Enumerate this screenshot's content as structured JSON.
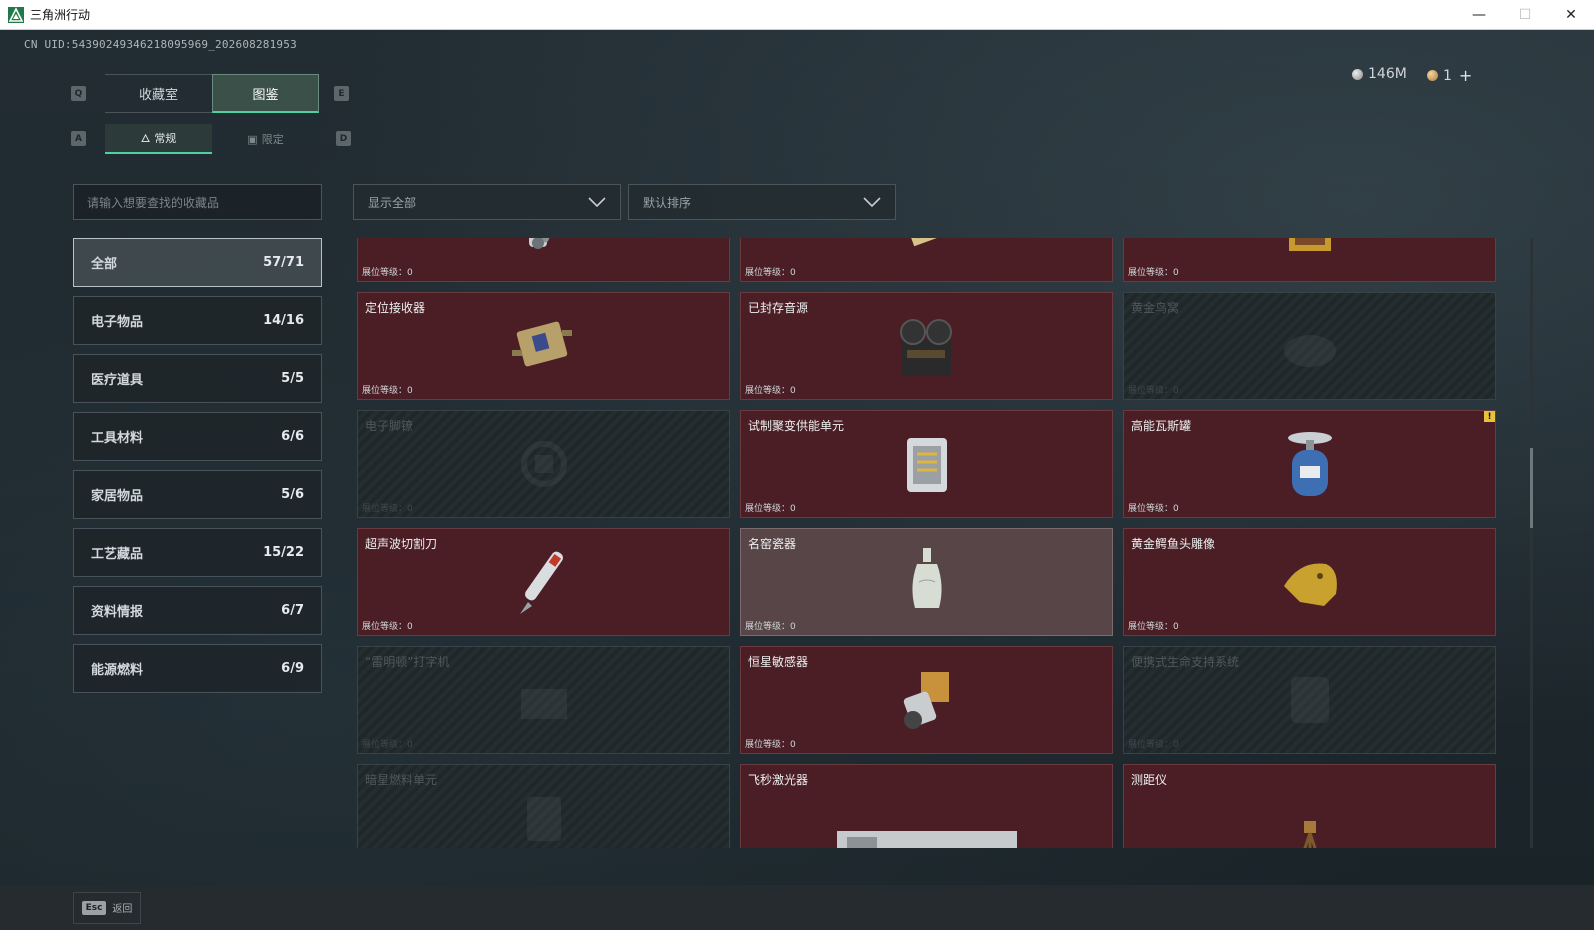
{
  "window": {
    "title": "三角洲行动",
    "minimize": "—",
    "maximize": "☐",
    "close": "✕"
  },
  "uid_text": "CN UID:54390249346218095969_202608281953",
  "currency": {
    "silver": "146M",
    "gold": "1",
    "plus": "+"
  },
  "keyhints": {
    "tab_left": "Q",
    "tab_right": "E",
    "sub_left": "A",
    "sub_right": "D"
  },
  "tabs": [
    {
      "label": "收藏室"
    },
    {
      "label": "图鉴"
    }
  ],
  "subtabs": [
    {
      "label": "常规",
      "icon": "flame-icon"
    },
    {
      "label": "限定",
      "icon": "picture-icon"
    }
  ],
  "search": {
    "placeholder": "请输入想要查找的收藏品"
  },
  "filter": {
    "value": "显示全部"
  },
  "sort": {
    "value": "默认排序"
  },
  "categories": [
    {
      "label": "全部",
      "count": "57/71"
    },
    {
      "label": "电子物品",
      "count": "14/16"
    },
    {
      "label": "医疗道具",
      "count": "5/5"
    },
    {
      "label": "工具材料",
      "count": "6/6"
    },
    {
      "label": "家居物品",
      "count": "5/6"
    },
    {
      "label": "工艺藏品",
      "count": "15/22"
    },
    {
      "label": "资料情报",
      "count": "6/7"
    },
    {
      "label": "能源燃料",
      "count": "6/9"
    }
  ],
  "level_label": "展位等级：0",
  "items": [
    {
      "name": "",
      "state": "owned",
      "icon": "mechanical-arm-icon"
    },
    {
      "name": "",
      "state": "owned",
      "icon": "ornate-book-icon"
    },
    {
      "name": "",
      "state": "owned",
      "icon": "framed-painting-icon"
    },
    {
      "name": "定位接收器",
      "state": "owned",
      "icon": "receiver-device-icon"
    },
    {
      "name": "已封存音源",
      "state": "owned",
      "icon": "reel-recorder-icon"
    },
    {
      "name": "黄金鸟窝",
      "state": "locked",
      "icon": "bird-nest-icon"
    },
    {
      "name": "电子脚镣",
      "state": "locked",
      "icon": "ankle-monitor-icon"
    },
    {
      "name": "试制聚变供能单元",
      "state": "owned",
      "icon": "fusion-cell-icon"
    },
    {
      "name": "高能瓦斯罐",
      "state": "owned",
      "icon": "gas-canister-icon",
      "badge": "!"
    },
    {
      "name": "超声波切割刀",
      "state": "owned",
      "icon": "ultrasonic-cutter-icon"
    },
    {
      "name": "名窑瓷器",
      "state": "owned-light",
      "icon": "porcelain-vase-icon"
    },
    {
      "name": "黄金鳄鱼头雕像",
      "state": "owned",
      "icon": "gold-croc-head-icon"
    },
    {
      "name": "“雷明顿”打字机",
      "state": "locked",
      "icon": "typewriter-icon"
    },
    {
      "name": "恒星敏感器",
      "state": "owned",
      "icon": "star-sensor-icon"
    },
    {
      "name": "便携式生命支持系统",
      "state": "locked",
      "icon": "life-support-icon"
    },
    {
      "name": "暗星燃料单元",
      "state": "locked",
      "icon": "fuel-cell-icon"
    },
    {
      "name": "飞秒激光器",
      "state": "owned",
      "icon": "laser-device-icon"
    },
    {
      "name": "测距仪",
      "state": "owned",
      "icon": "rangefinder-tripod-icon"
    }
  ],
  "bottom": {
    "esc_key": "Esc",
    "esc_label": "返回"
  },
  "colors": {
    "accent": "#4fd0a0",
    "owned_card": "#4a1e24",
    "locked_card": "#1f2729",
    "badge": "#e7c33a"
  }
}
